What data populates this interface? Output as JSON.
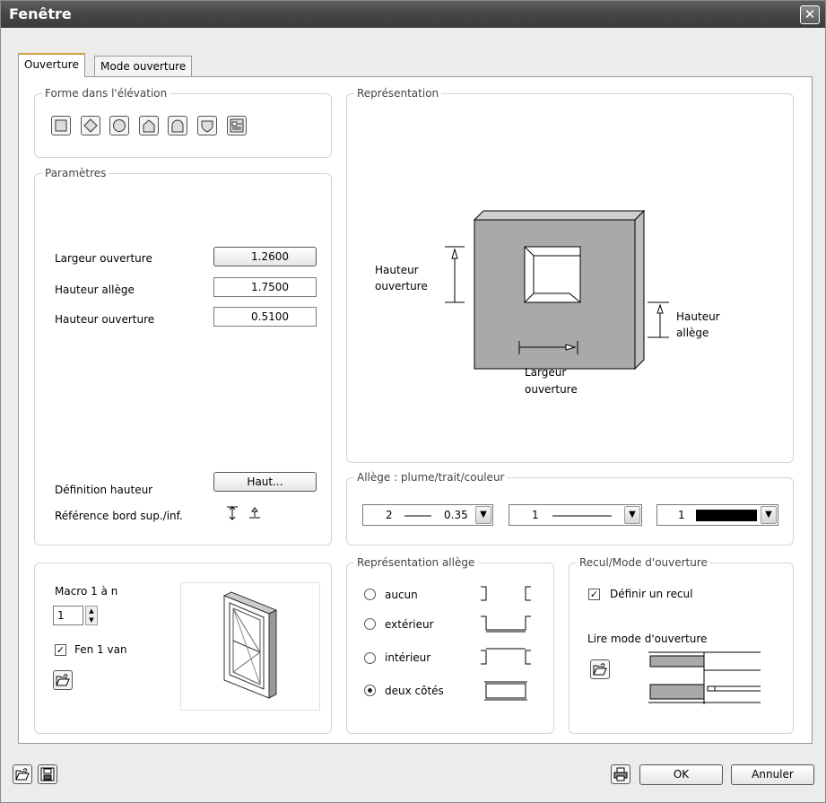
{
  "window": {
    "title": "Fenêtre",
    "close_glyph": "✕"
  },
  "tabs": [
    {
      "label": "Ouverture",
      "active": true
    },
    {
      "label": "Mode ouverture",
      "active": false
    }
  ],
  "forme": {
    "title": "Forme dans l'élévation",
    "shapes": [
      "rectangle-icon",
      "diamond-icon",
      "circle-icon",
      "pentagon-icon",
      "arch-icon",
      "shield-icon",
      "custom-shape-icon"
    ]
  },
  "parametres": {
    "title": "Paramètres",
    "largeur_label": "Largeur ouverture",
    "largeur_value": "1.2600",
    "hauteur_allege_label": "Hauteur allège",
    "hauteur_allege_value": "1.7500",
    "hauteur_ouverture_label": "Hauteur ouverture",
    "hauteur_ouverture_value": "0.5100",
    "definition_label": "Définition hauteur",
    "definition_button": "Haut...",
    "reference_label": "Référence bord sup./inf."
  },
  "representation": {
    "title": "Représentation",
    "hauteur_ouverture": [
      "Hauteur",
      "ouverture"
    ],
    "hauteur_allege": [
      "Hauteur",
      "allège"
    ],
    "largeur_ouverture": [
      "Largeur",
      "ouverture"
    ]
  },
  "allege_pen": {
    "title": "Allège : plume/trait/couleur",
    "pen": "2",
    "line_weight": "0.35",
    "line_type": "1",
    "color_index": "1",
    "color_hex": "#000000"
  },
  "macro": {
    "label": "Macro 1 à n",
    "value": "1",
    "checkbox_label": "Fen 1 van",
    "checkbox_checked": true
  },
  "representation_allege": {
    "title": "Représentation allège",
    "options": [
      {
        "label": "aucun",
        "checked": false
      },
      {
        "label": "extérieur",
        "checked": false
      },
      {
        "label": "intérieur",
        "checked": false
      },
      {
        "label": "deux côtés",
        "checked": true
      }
    ]
  },
  "recul": {
    "title": "Recul/Mode d'ouverture",
    "checkbox_label": "Définir un recul",
    "checkbox_checked": true,
    "lire_label": "Lire mode d'ouverture"
  },
  "footer": {
    "ok_label": "OK",
    "cancel_label": "Annuler"
  },
  "colors": {
    "wall_fill": "#a9a9a9",
    "title_bar": "#474747"
  }
}
